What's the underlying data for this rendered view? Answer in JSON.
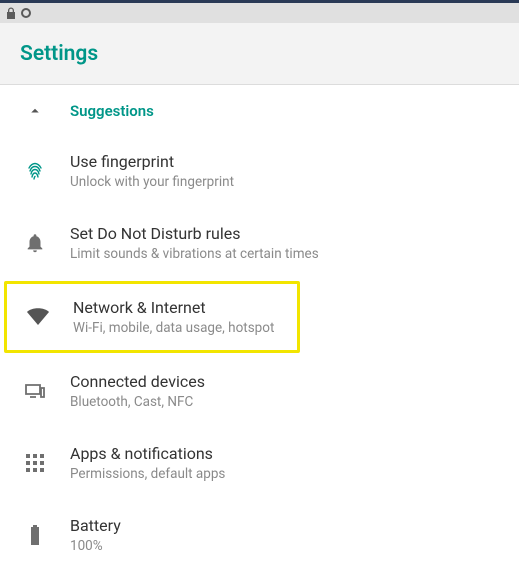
{
  "app": {
    "title": "Settings"
  },
  "suggestions_header": {
    "label": "Suggestions"
  },
  "rows": [
    {
      "icon": "fingerprint",
      "title": "Use fingerprint",
      "subtitle": "Unlock with your fingerprint"
    },
    {
      "icon": "bell",
      "title": "Set Do Not Disturb rules",
      "subtitle": "Limit sounds & vibrations at certain times"
    },
    {
      "icon": "wifi",
      "title": "Network & Internet",
      "subtitle": "Wi-Fi, mobile, data usage, hotspot",
      "highlighted": true
    },
    {
      "icon": "devices",
      "title": "Connected devices",
      "subtitle": "Bluetooth, Cast, NFC"
    },
    {
      "icon": "apps",
      "title": "Apps & notifications",
      "subtitle": "Permissions, default apps"
    },
    {
      "icon": "battery",
      "title": "Battery",
      "subtitle": "100%"
    }
  ]
}
